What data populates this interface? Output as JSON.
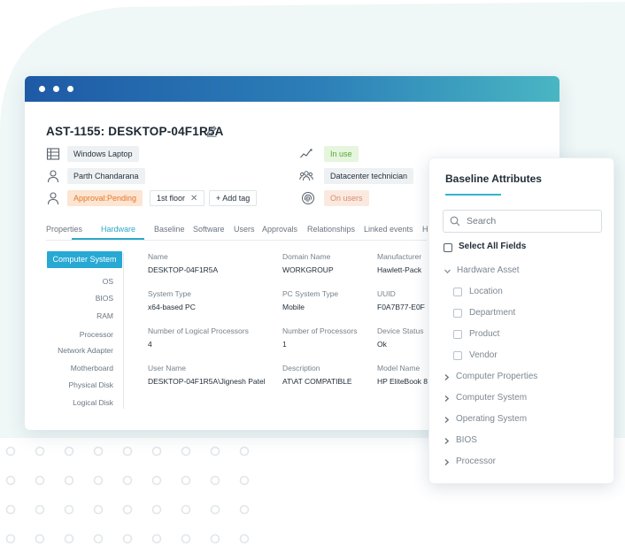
{
  "asset": {
    "title": "AST-1155: DESKTOP-04F1R5A",
    "type": "Windows Laptop",
    "owner": "Parth Chandarana",
    "approval": "Approval:Pending",
    "tag": "1st floor",
    "add_tag": "+ Add tag",
    "status": "In use",
    "managed_by": "Datacenter technician",
    "users_status": "On users"
  },
  "tabs": [
    "Properties",
    "Hardware",
    "Baseline",
    "Software",
    "Users",
    "Approvals",
    "Relationships",
    "Linked events",
    "H"
  ],
  "active_tab": "Hardware",
  "sidebar": {
    "active": "Computer System",
    "items": [
      "OS",
      "BIOS",
      "RAM",
      "Processor",
      "Network Adapter",
      "Motherboard",
      "Physical Disk",
      "Logical Disk"
    ]
  },
  "fields": {
    "name": {
      "label": "Name",
      "value": "DESKTOP-04F1R5A"
    },
    "domain_name": {
      "label": "Domain Name",
      "value": "WORKGROUP"
    },
    "manufacturer": {
      "label": "Manufacturer",
      "value": "Hawlett-Pack"
    },
    "system_type": {
      "label": "System Type",
      "value": "x64-based PC"
    },
    "pc_system_type": {
      "label": "PC System Type",
      "value": "Mobile"
    },
    "uuid": {
      "label": "UUID",
      "value": "F0A7B77-E0F"
    },
    "logical_processors": {
      "label": "Number of Logical Processors",
      "value": "4"
    },
    "processors": {
      "label": "Number of Processors",
      "value": "1"
    },
    "device_status": {
      "label": "Device Status",
      "value": "Ok"
    },
    "user_name": {
      "label": "User Name",
      "value": "DESKTOP-04F1R5A\\Jignesh Patel"
    },
    "description": {
      "label": "Description",
      "value": "AT\\AT COMPATIBLE"
    },
    "model_name": {
      "label": "Model Name",
      "value": "HP EliteBook 8"
    }
  },
  "baseline_panel": {
    "title": "Baseline Attributes",
    "search_placeholder": "Search",
    "select_all": "Select All Fields",
    "hardware_asset": "Hardware Asset",
    "hardware_children": [
      "Location",
      "Department",
      "Product",
      "Vendor"
    ],
    "groups": [
      "Computer Properties",
      "Computer System",
      "Operating System",
      "BIOS",
      "Processor"
    ]
  },
  "colors": {
    "accent": "#2fa8c6",
    "titlebar_start": "#1e5aa6",
    "titlebar_end": "#49b6c3",
    "approval_pending": "#e2792c",
    "in_use": "#5aa63a"
  },
  "icons": [
    "pencil-icon",
    "asset-type-icon",
    "user-icon",
    "approval-user-icon",
    "activity-icon",
    "team-icon",
    "fingerprint-icon",
    "search-icon",
    "chevron-down-icon",
    "chevron-right-icon",
    "close-icon"
  ]
}
